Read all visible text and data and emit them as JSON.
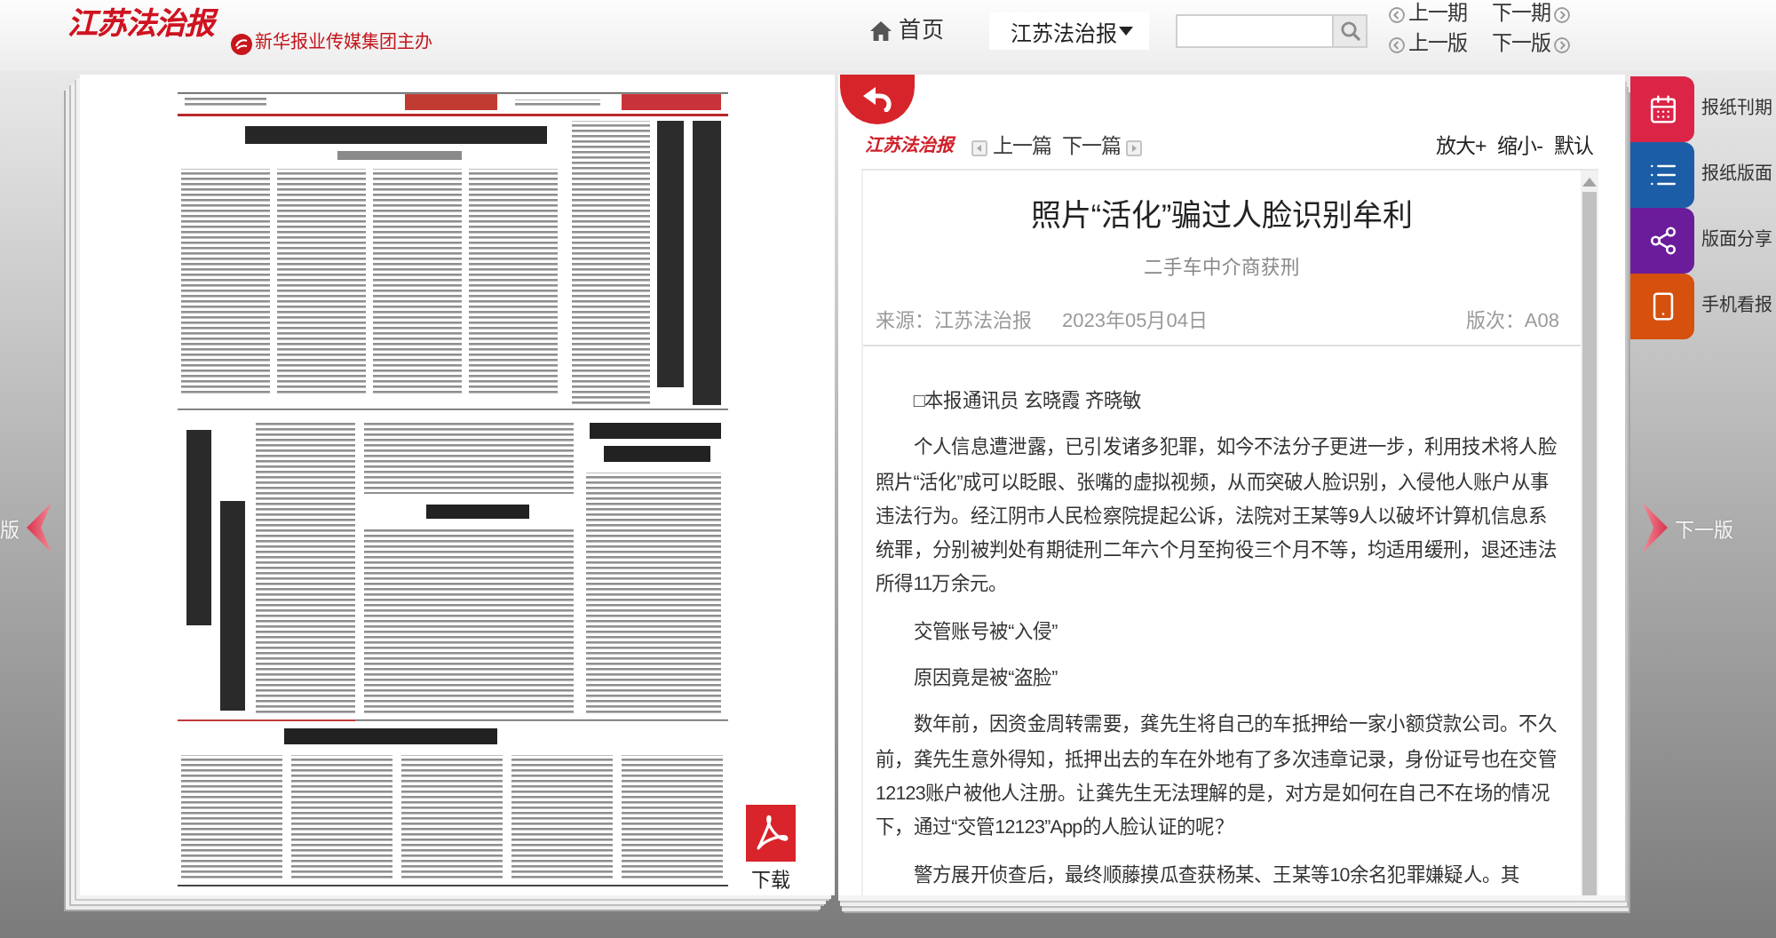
{
  "header": {
    "logo": "江苏法治报",
    "publisher": "新华报业传媒集团主办",
    "home": "首页",
    "paper_select": {
      "value": "江苏法治报"
    },
    "issue_nav": [
      {
        "kind": "prev",
        "label": "上一期"
      },
      {
        "kind": "next",
        "label": "下一期"
      },
      {
        "kind": "prev",
        "label": "上一版"
      },
      {
        "kind": "next",
        "label": "下一版"
      }
    ]
  },
  "prev_page": "版",
  "newspaper_page": {
    "download": "下载"
  },
  "article_panel": {
    "toolbar": {
      "logo": "江苏法治报",
      "article_nav": [
        {
          "kind": "prev",
          "label": "上一篇"
        },
        {
          "kind": "next",
          "label": "下一篇"
        }
      ],
      "zoom": [
        "放大+",
        "缩小-",
        "默认"
      ]
    },
    "title": "照片“活化”骗过人脸识别牟利",
    "subtitle": "二手车中介商获刑",
    "meta": {
      "source": "来源：江苏法治报",
      "date": "2023年05月04日",
      "page": "版次：A08"
    },
    "paragraphs": [
      "□本报通讯员 玄晓霞 齐晓敏",
      "个人信息遭泄露，已引发诸多犯罪，如今不法分子更进一步，利用技术将人脸照片“活化”成可以眨眼、张嘴的虚拟视频，从而突破人脸识别，入侵他人账户从事违法行为。经江阴市人民检察院提起公诉，法院对王某等9人以破坏计算机信息系统罪，分别被判处有期徒刑二年六个月至拘役三个月不等，均适用缓刑，退还违法所得11万余元。",
      "交管账号被“入侵”",
      "原因竟是被“盗脸”",
      "数年前，因资金周转需要，龚先生将自己的车抵押给一家小额贷款公司。不久前，龚先生意外得知，抵押出去的车在外地有了多次违章记录，身份证号也在交管12123账户被他人注册。让龚先生无法理解的是，对方是如何在自己不在场的情况下，通过“交管12123”App的人脸认证的呢？",
      "警方展开侦查后，最终顺藤摸瓜查获杨某、王某等10余名犯罪嫌疑人。其"
    ]
  },
  "side_menu": [
    {
      "label": "报纸刊期",
      "color": "#dc2447"
    },
    {
      "label": "报纸版面",
      "color": "#1b5da6"
    },
    {
      "label": "版面分享",
      "color": "#6b1c9b"
    },
    {
      "label": "手机看报",
      "color": "#d6500e"
    }
  ],
  "next_page": "下一版"
}
